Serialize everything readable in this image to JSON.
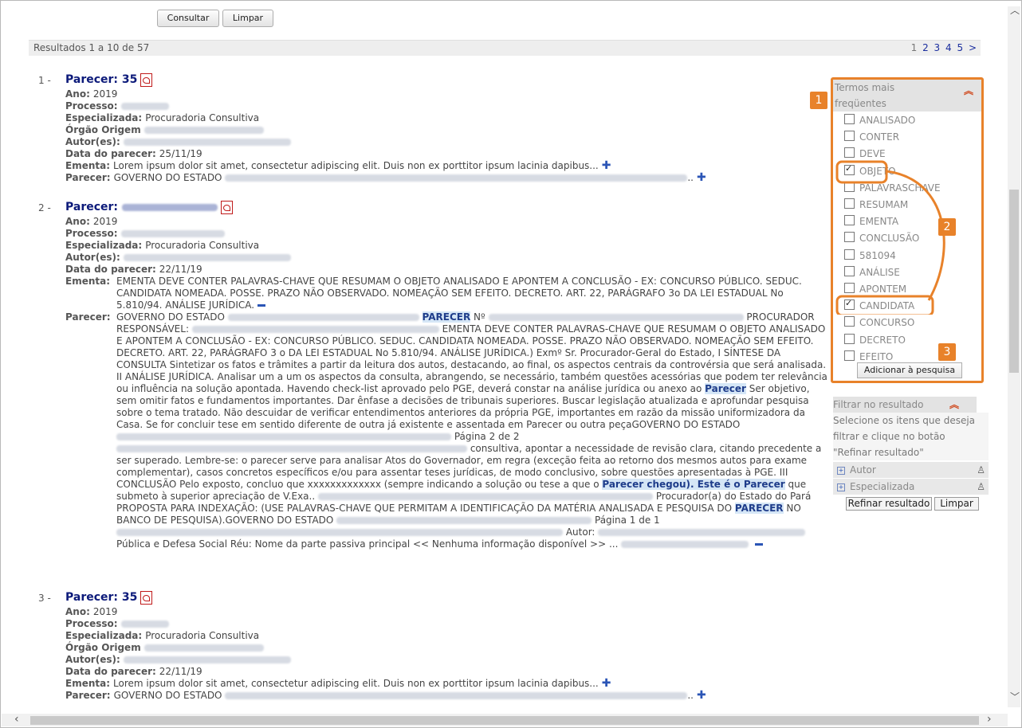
{
  "form": {
    "consultar": "Consultar",
    "limpar": "Limpar"
  },
  "results": {
    "summary": "Resultados 1 a 10 de 57",
    "pages": [
      "1",
      "2",
      "3",
      "4",
      "5",
      ">"
    ]
  },
  "items": [
    {
      "num": "1 -",
      "title": "Parecer: 35",
      "ano_label": "Ano:",
      "ano": "2019",
      "processo_label": "Processo:",
      "esp_label": "Especializada:",
      "esp": "Procuradoria Consultiva",
      "orgao_label": "Órgão Origem",
      "autor_label": "Autor(es):",
      "data_label": "Data do parecer:",
      "data": "25/11/19",
      "ementa_label": "Ementa:",
      "ementa": "Lorem ipsum dolor sit amet, consectetur adipiscing elit. Duis non ex porttitor ipsum lacinia dapibus...",
      "parecer_label": "Parecer:",
      "parecer": "GOVERNO DO ESTADO",
      "parecer_end": ".."
    },
    {
      "num": "2 -",
      "title": "Parecer:",
      "ano_label": "Ano:",
      "ano": "2019",
      "processo_label": "Processo:",
      "esp_label": "Especializada:",
      "esp": "Procuradoria Consultiva",
      "autor_label": "Autor(es):",
      "data_label": "Data do parecer:",
      "data": "22/11/19",
      "ementa_label": "Ementa:",
      "ementa_full": "EMENTA DEVE CONTER PALAVRAS-CHAVE QUE RESUMAM O OBJETO ANALISADO E APONTEM A CONCLUSÃO - EX: CONCURSO PÚBLICO. SEDUC. CANDIDATA NOMEADA. POSSE. PRAZO NÃO OBSERVADO. NOMEAÇÃO SEM EFEITO. DECRETO. ART. 22, PARÁGRAFO 3o DA LEI ESTADUAL No 5.810/94. ANÁLISE JURÍDICA.",
      "parecer_label": "Parecer:",
      "p1": "GOVERNO DO ESTADO",
      "hl1": "PARECER",
      "p2": "Nº",
      "p3": "PROCURADOR",
      "p4": "RESPONSÁVEL:",
      "p5": "EMENTA DEVE CONTER PALAVRAS-CHAVE QUE RESUMAM O OBJETO ANALISADO E APONTEM A CONCLUSÃO - EX: CONCURSO PÚBLICO. SEDUC. CANDIDATA NOMEADA. POSSE. PRAZO NÃO OBSERVADO. NOMEAÇÃO SEM EFEITO. DECRETO. ART. 22, PARÁGRAFO 3 o DA LEI ESTADUAL No 5.810/94. ANÁLISE JURÍDICA.) Exmº Sr. Procurador-Geral do Estado, I SÍNTESE DA CONSULTA Sintetizar os fatos e trâmites a partir da leitura dos autos, destacando, ao final, os aspectos centrais da controvérsia que será analisada. II ANÁLISE JURÍDICA. Analisar um a um os aspectos da consulta, abrangendo, se necessário, também questões acessórias que podem ter relevância ou influência na solução apontada. Havendo check-list aprovado pelo PGE, deverá constar na análise jurídica ou anexo ao",
      "hl2": "Parecer",
      "p6": "Ser objetivo, sem omitir fatos e fundamentos importantes. Dar ênfase a decisões de tribunais superiores. Buscar legislação atualizada e aprofundar pesquisa sobre o tema tratado. Não descuidar de verificar entendimentos anteriores da própria PGE, importantes em razão da missão uniformizadora da Casa. Se for concluir tese em sentido diferente de outra já existente e assentada em Parecer ou outra peçaGOVERNO DO ESTADO",
      "p7": "Página 2 de 2",
      "p8": "consultiva, apontar a necessidade de revisão clara, citando precedente a ser superado. Lembre-se: o parecer serve para analisar Atos do Governador, em regra (exceção feita ao retorno dos mesmos autos para exame complementar), casos concretos específicos e/ou para assentar teses jurídicas, de modo conclusivo, sobre questões apresentadas à PGE. III CONCLUSÃO Pelo exposto, concluo que xxxxxxxxxxxxx (sempre indicando a solução ou tese a que o",
      "hl3": "Parecer chegou). Este é o Parecer",
      "p9": "que submeto à superior apreciação de V.Exa..",
      "p10": "Procurador(a) do Estado do Pará PROPOSTA PARA INDEXAÇÃO: (USE PALAVRAS-CHAVE QUE PERMITAM A IDENTIFICAÇÃO DA MATÉRIA ANALISADA E PESQUISA DO",
      "hl4": "PARECER",
      "p11": "NO BANCO DE PESQUISA).GOVERNO DO ESTADO",
      "p12": "Página 1 de 1",
      "p13": "Autor:",
      "p14": "Pública e Defesa Social Réu: Nome da parte passiva principal << Nenhuma informação disponível >> ..."
    },
    {
      "num": "3 -",
      "title": "Parecer: 35",
      "ano_label": "Ano:",
      "ano": "2019",
      "processo_label": "Processo:",
      "esp_label": "Especializada:",
      "esp": "Procuradoria Consultiva",
      "orgao_label": "Órgão Origem",
      "autor_label": "Autor(es):",
      "data_label": "Data do parecer:",
      "data": "22/11/19",
      "ementa_label": "Ementa:",
      "ementa": "Lorem ipsum dolor sit amet, consectetur adipiscing elit. Duis non ex porttitor ipsum lacinia dapibus...",
      "parecer_label": "Parecer:",
      "parecer": "GOVERNO DO ESTADO",
      "parecer_end": ".."
    }
  ],
  "sidebar": {
    "terms_title_1": "Termos mais",
    "terms_title_2": "freqüentes",
    "terms": [
      {
        "label": "ANALISADO",
        "checked": false
      },
      {
        "label": "CONTER",
        "checked": false
      },
      {
        "label": "DEVE",
        "checked": false
      },
      {
        "label": "OBJETO",
        "checked": true
      },
      {
        "label": "PALAVRASCHAVE",
        "checked": false
      },
      {
        "label": "RESUMAM",
        "checked": false
      },
      {
        "label": "EMENTA",
        "checked": false
      },
      {
        "label": "CONCLUSÃO",
        "checked": false
      },
      {
        "label": "581094",
        "checked": false
      },
      {
        "label": "ANÁLISE",
        "checked": false
      },
      {
        "label": "APONTEM",
        "checked": false
      },
      {
        "label": "CANDIDATA",
        "checked": true
      },
      {
        "label": "CONCURSO",
        "checked": false
      },
      {
        "label": "DECRETO",
        "checked": false
      },
      {
        "label": "EFEITO",
        "checked": false
      }
    ],
    "add_button": "Adicionar à pesquisa",
    "filter_title": "Filtrar no resultado",
    "filter_desc_1": "Selecione os itens que deseja",
    "filter_desc_2": "filtrar e clique no botão",
    "filter_desc_3": "\"Refinar resultado\"",
    "facet_autor": "Autor",
    "facet_esp": "Especializada",
    "refine_button": "Refinar resultado",
    "clear_button": "Limpar"
  },
  "badges": [
    "1",
    "2",
    "3"
  ],
  "colors": {
    "accent": "#e8822a",
    "title": "#0c1a7a",
    "link": "#1a2d9e",
    "highlight": "#d5e6f6"
  }
}
